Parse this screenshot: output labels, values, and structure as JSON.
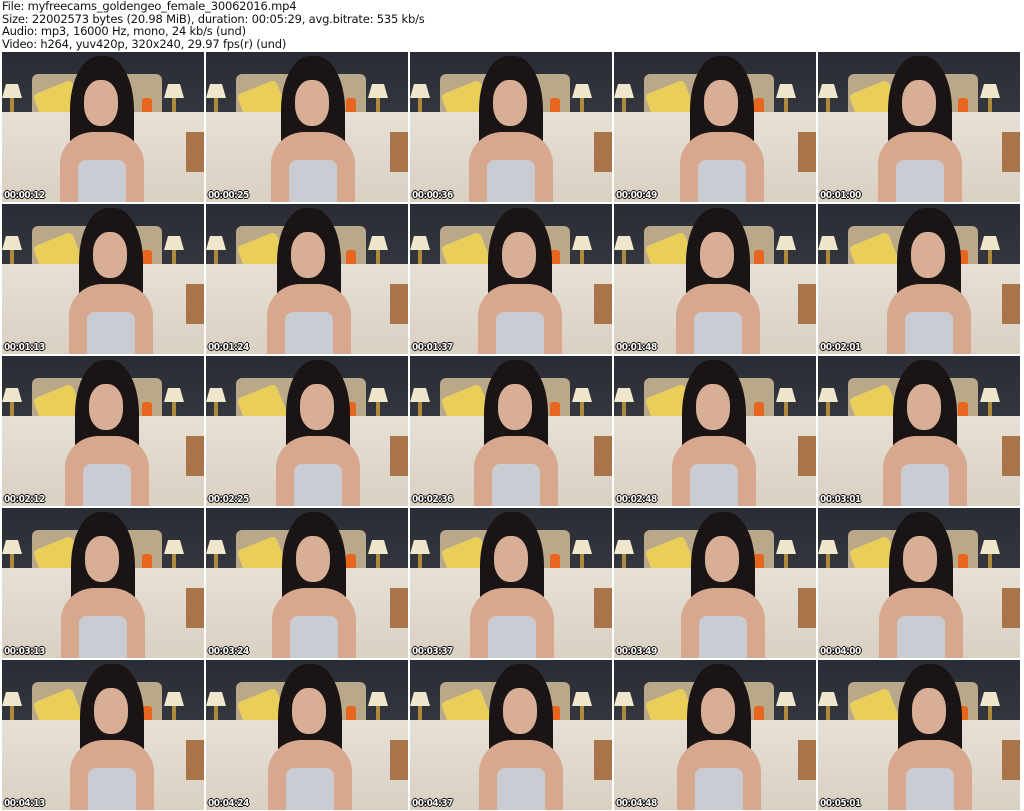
{
  "header": {
    "lines": [
      "File: myfreecams_goldengeo_female_30062016.mp4",
      "Size: 22002573 bytes (20.98 MiB), duration: 00:05:29, avg.bitrate: 535 kb/s",
      "Audio: mp3, 16000 Hz, mono, 24 kb/s (und)",
      "Video: h264, yuv420p, 320x240, 29.97 fps(r) (und)"
    ]
  },
  "thumbnails": [
    {
      "timestamp": "00:00:12"
    },
    {
      "timestamp": "00:00:25"
    },
    {
      "timestamp": "00:00:36"
    },
    {
      "timestamp": "00:00:49"
    },
    {
      "timestamp": "00:01:00"
    },
    {
      "timestamp": "00:01:13"
    },
    {
      "timestamp": "00:01:24"
    },
    {
      "timestamp": "00:01:37"
    },
    {
      "timestamp": "00:01:48"
    },
    {
      "timestamp": "00:02:01"
    },
    {
      "timestamp": "00:02:12"
    },
    {
      "timestamp": "00:02:25"
    },
    {
      "timestamp": "00:02:36"
    },
    {
      "timestamp": "00:02:48"
    },
    {
      "timestamp": "00:03:01"
    },
    {
      "timestamp": "00:03:13"
    },
    {
      "timestamp": "00:03:24"
    },
    {
      "timestamp": "00:03:37"
    },
    {
      "timestamp": "00:03:49"
    },
    {
      "timestamp": "00:04:00"
    },
    {
      "timestamp": "00:04:13"
    },
    {
      "timestamp": "00:04:24"
    },
    {
      "timestamp": "00:04:37"
    },
    {
      "timestamp": "00:04:48"
    },
    {
      "timestamp": "00:05:01"
    }
  ]
}
